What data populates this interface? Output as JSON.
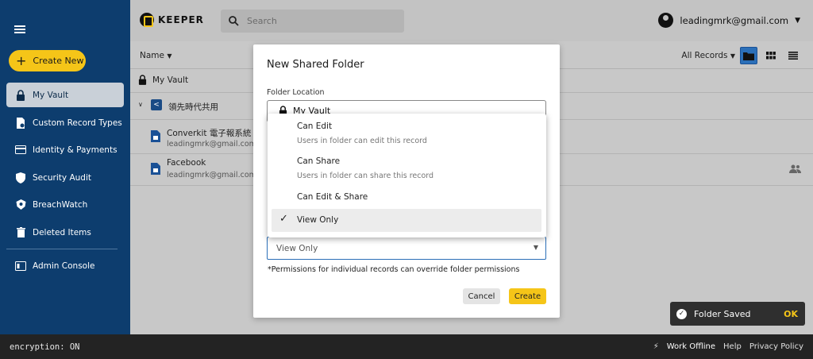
{
  "header": {
    "brand": "KEEPER",
    "search_placeholder": "Search",
    "account_email": "leadingmrk@gmail.com"
  },
  "sidebar": {
    "create_label": "Create New",
    "items": [
      {
        "label": "My Vault",
        "icon": "lock-icon",
        "active": true
      },
      {
        "label": "Custom Record Types",
        "icon": "record-types-icon"
      },
      {
        "label": "Identity & Payments",
        "icon": "credit-card-icon"
      },
      {
        "label": "Security Audit",
        "icon": "shield-icon"
      },
      {
        "label": "BreachWatch",
        "icon": "breachwatch-icon"
      },
      {
        "label": "Deleted Items",
        "icon": "trash-icon"
      },
      {
        "label": "Admin Console",
        "icon": "admin-console-icon"
      }
    ]
  },
  "list": {
    "sort_label": "Name",
    "filter_label": "All Records",
    "my_vault_label": "My Vault",
    "shared_folder": "領先時代共用",
    "records": [
      {
        "title": "Converkit 電子報系統",
        "subtitle": "leadingmrk@gmail.com"
      },
      {
        "title": "Facebook",
        "subtitle": "leadingmrk@gmail.com"
      }
    ]
  },
  "modal": {
    "title": "New Shared Folder",
    "location_label": "Folder Location",
    "location_value": "My Vault",
    "permission_value": "View Only",
    "note": "*Permissions for individual records can override folder permissions",
    "cancel_label": "Cancel",
    "create_label": "Create"
  },
  "menu": {
    "options": [
      {
        "label": "Can Edit",
        "description": "Users in folder can edit this record"
      },
      {
        "label": "Can Share",
        "description": "Users in folder can share this record"
      },
      {
        "label": "Can Edit & Share"
      },
      {
        "label": "View Only",
        "selected": true
      }
    ]
  },
  "toast": {
    "message": "Folder Saved",
    "action": "OK"
  },
  "footer": {
    "encryption": "encryption: ON",
    "work_offline": "Work Offline",
    "help": "Help",
    "privacy": "Privacy Policy"
  },
  "colors": {
    "sidebar_bg": "#0d3d6e",
    "accent_yellow": "#f5c518",
    "selected_view": "#2b6fb8"
  }
}
